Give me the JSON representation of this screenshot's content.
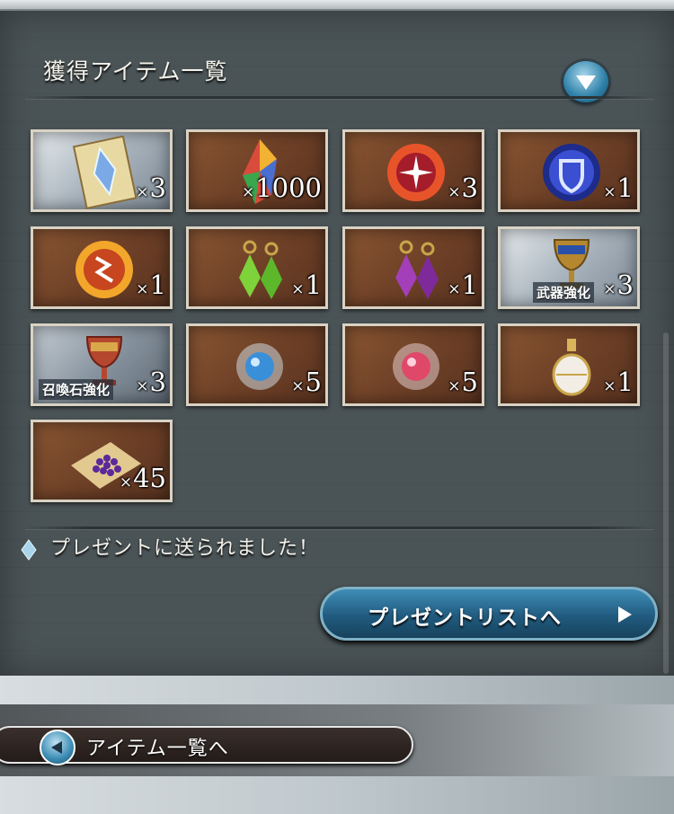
{
  "panel": {
    "title": "獲得アイテム一覧",
    "collapse_icon": "chevron-down-icon"
  },
  "items": [
    {
      "icon": "crystal-card-icon",
      "qty": "3"
    },
    {
      "icon": "rainbow-crystal-icon",
      "qty": "1000"
    },
    {
      "icon": "fire-orb-icon",
      "qty": "3"
    },
    {
      "icon": "shield-orb-icon",
      "qty": "1"
    },
    {
      "icon": "lightning-orb-icon",
      "qty": "1"
    },
    {
      "icon": "green-earrings-icon",
      "qty": "1"
    },
    {
      "icon": "purple-earrings-icon",
      "qty": "1"
    },
    {
      "icon": "weapon-grail-icon",
      "qty": "3",
      "label": "武器強化"
    },
    {
      "icon": "summon-grail-icon",
      "qty": "3",
      "label": "召喚石強化"
    },
    {
      "icon": "blue-pearl-icon",
      "qty": "5"
    },
    {
      "icon": "pink-pearl-icon",
      "qty": "5"
    },
    {
      "icon": "perfume-bottle-icon",
      "qty": "1"
    },
    {
      "icon": "seed-pile-icon",
      "qty": "45"
    }
  ],
  "qty_prefix": "×",
  "notice": "プレゼントに送られました！",
  "present_button": {
    "label": "プレゼントリストへ"
  },
  "back_button": {
    "label": "アイテム一覧へ"
  },
  "colors": {
    "panel_bg": "#4a5356",
    "tile_bronze": "#7a4a2c",
    "button_blue": "#2b6f97"
  }
}
